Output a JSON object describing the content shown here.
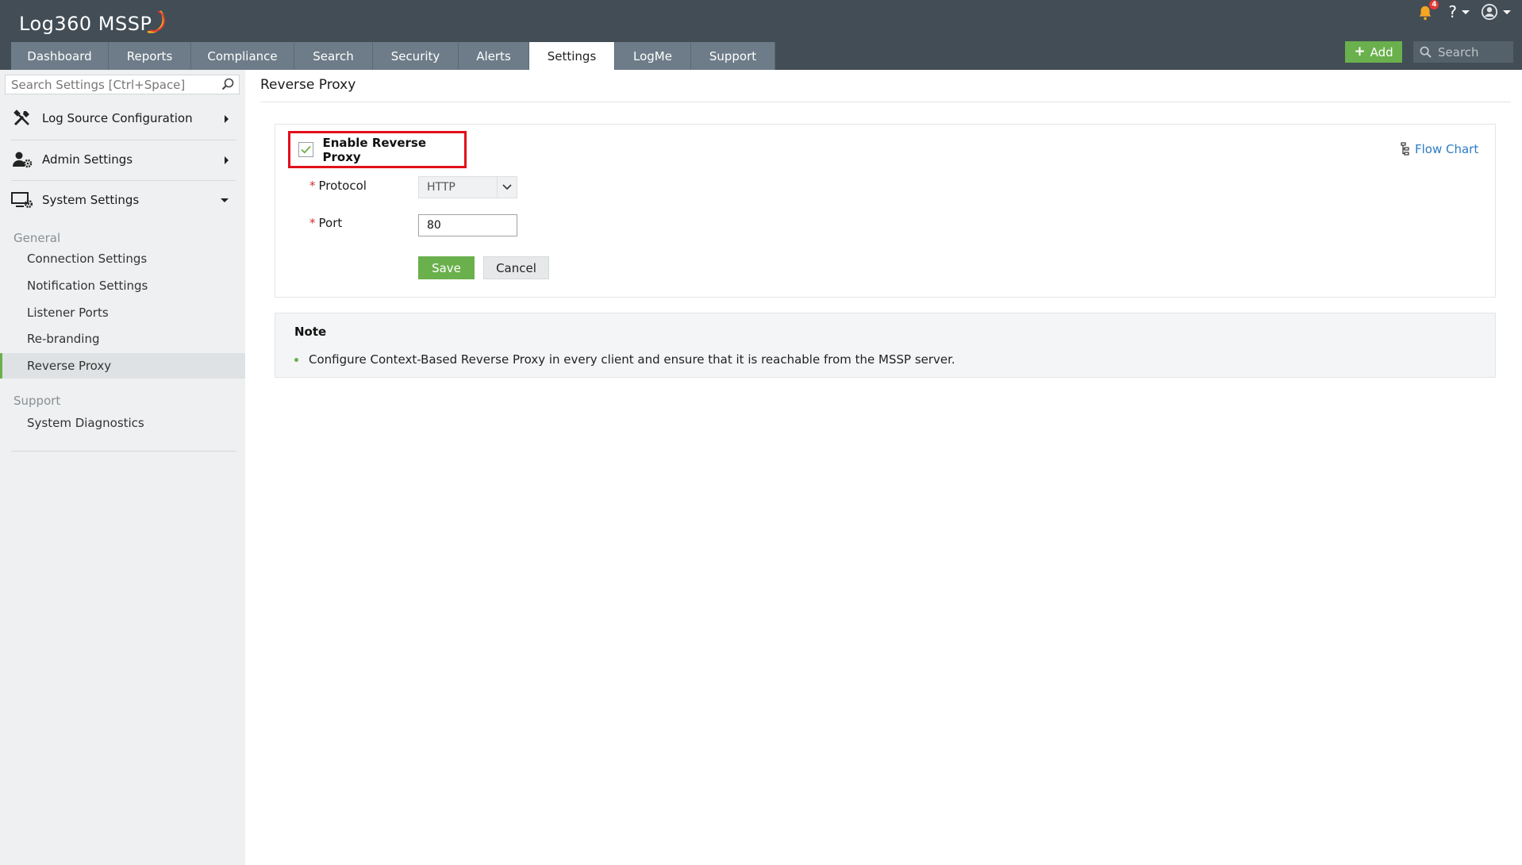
{
  "app": {
    "logo_text": "Log360 MSSP",
    "notification_count": "4"
  },
  "header": {
    "tabs": [
      {
        "label": "Dashboard"
      },
      {
        "label": "Reports"
      },
      {
        "label": "Compliance"
      },
      {
        "label": "Search"
      },
      {
        "label": "Security"
      },
      {
        "label": "Alerts"
      },
      {
        "label": "Settings",
        "active": true
      },
      {
        "label": "LogMe"
      },
      {
        "label": "Support"
      }
    ],
    "add_label": "Add",
    "search_placeholder": "Search",
    "help_icon": "?"
  },
  "sidebar": {
    "search_placeholder": "Search Settings [Ctrl+Space]",
    "sections": [
      {
        "label": "Log Source Configuration",
        "icon": "tools-icon",
        "expanded": false
      },
      {
        "label": "Admin Settings",
        "icon": "admin-gear-icon",
        "expanded": false
      },
      {
        "label": "System Settings",
        "icon": "monitor-gear-icon",
        "expanded": true
      }
    ],
    "groups": [
      {
        "title": "General",
        "items": [
          "Connection Settings",
          "Notification Settings",
          "Listener Ports",
          "Re-branding",
          "Reverse Proxy"
        ]
      },
      {
        "title": "Support",
        "items": [
          "System Diagnostics"
        ]
      }
    ],
    "active_item": "Reverse Proxy"
  },
  "main": {
    "page_title": "Reverse Proxy",
    "enable_label": "Enable Reverse Proxy",
    "enable_checked": true,
    "flow_chart_label": "Flow Chart",
    "protocol_label": "Protocol",
    "protocol_value": "HTTP",
    "port_label": "Port",
    "port_value": "80",
    "required_mark": "*",
    "save_label": "Save",
    "cancel_label": "Cancel"
  },
  "note": {
    "title": "Note",
    "items": [
      "Configure Context-Based Reverse Proxy in every client and ensure that it is reachable from the MSSP server."
    ]
  },
  "colors": {
    "header_bg": "#424d56",
    "accent_green": "#6ab04c",
    "highlight_red": "#e2101a",
    "link_blue": "#2b7bc4"
  }
}
